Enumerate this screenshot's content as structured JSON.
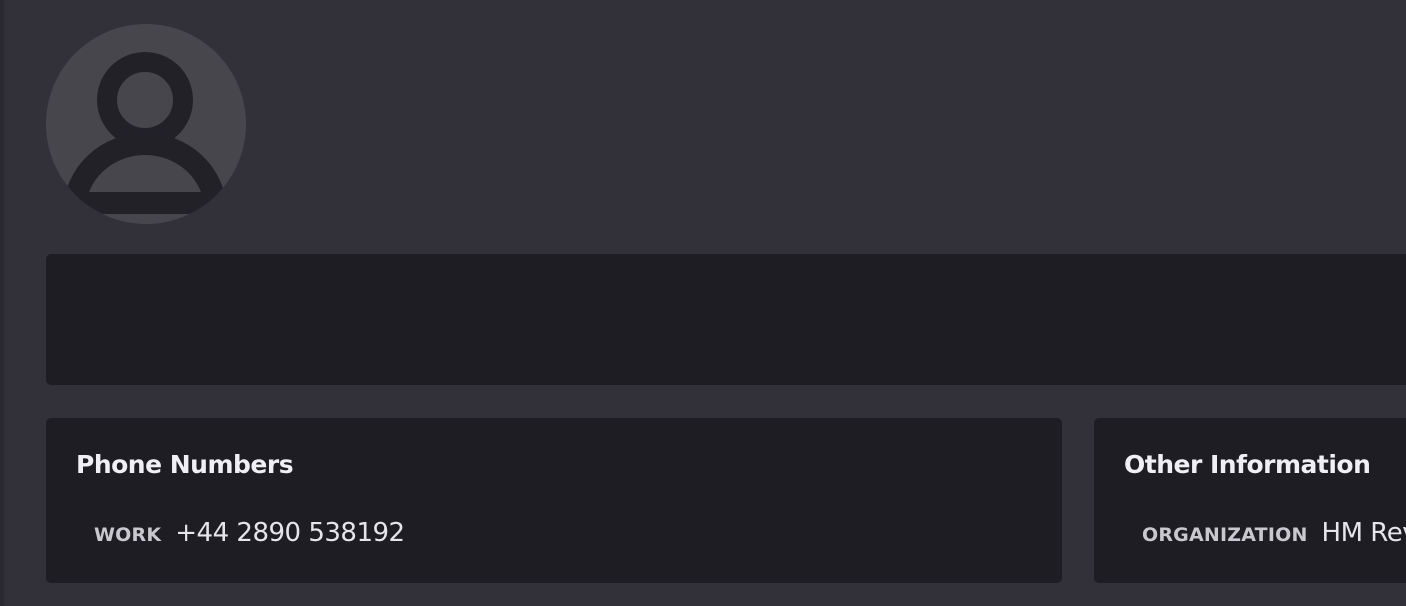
{
  "colors": {
    "background": "#323139",
    "card": "#1e1d23",
    "avatar_bg": "#47464d",
    "avatar_glyph": "#222128",
    "title_text": "#f0eff3",
    "label_text": "#c9c8cf"
  },
  "contact": {
    "avatar_icon": "person-icon",
    "name": ""
  },
  "phone_numbers": {
    "title": "Phone Numbers",
    "entries": [
      {
        "label": "WORK",
        "value": "+44 2890 538192"
      }
    ]
  },
  "other_information": {
    "title": "Other Information",
    "entries": [
      {
        "label": "ORGANIZATION",
        "value": "HM Rev"
      }
    ]
  }
}
